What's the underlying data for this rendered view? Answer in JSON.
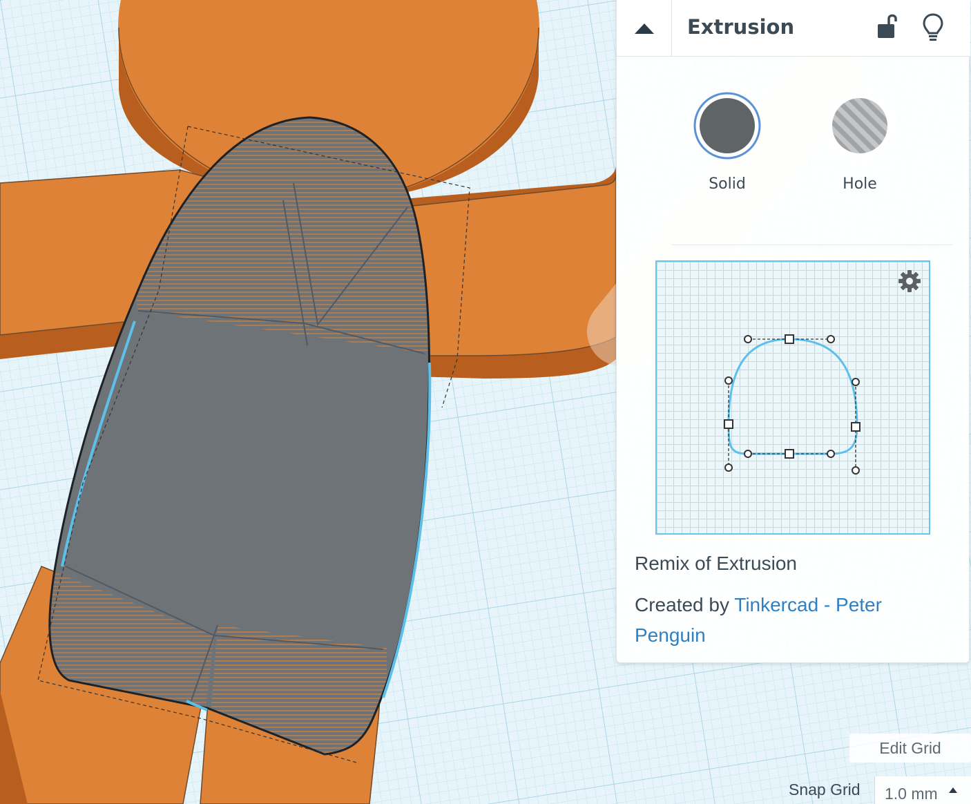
{
  "panel": {
    "title": "Extrusion",
    "modes": [
      {
        "label": "Solid",
        "selected": true
      },
      {
        "label": "Hole",
        "selected": false
      }
    ],
    "remix_text": "Remix of Extrusion",
    "created_prefix": "Created by ",
    "author": "Tinkercad - Peter Penguin"
  },
  "grid": {
    "edit_label": "Edit Grid",
    "snap_label": "Snap Grid",
    "snap_value": "1.0 mm"
  },
  "colors": {
    "workplane": "#e4f3f8",
    "shape_orange": "#dd8236",
    "extrusion_gray": "#6d7377",
    "selection_blue": "#5ec0ea",
    "link": "#2f80c2"
  },
  "icons": [
    "chevron-up-icon",
    "unlock-icon",
    "lightbulb-icon",
    "gear-icon",
    "caret-up-icon"
  ]
}
